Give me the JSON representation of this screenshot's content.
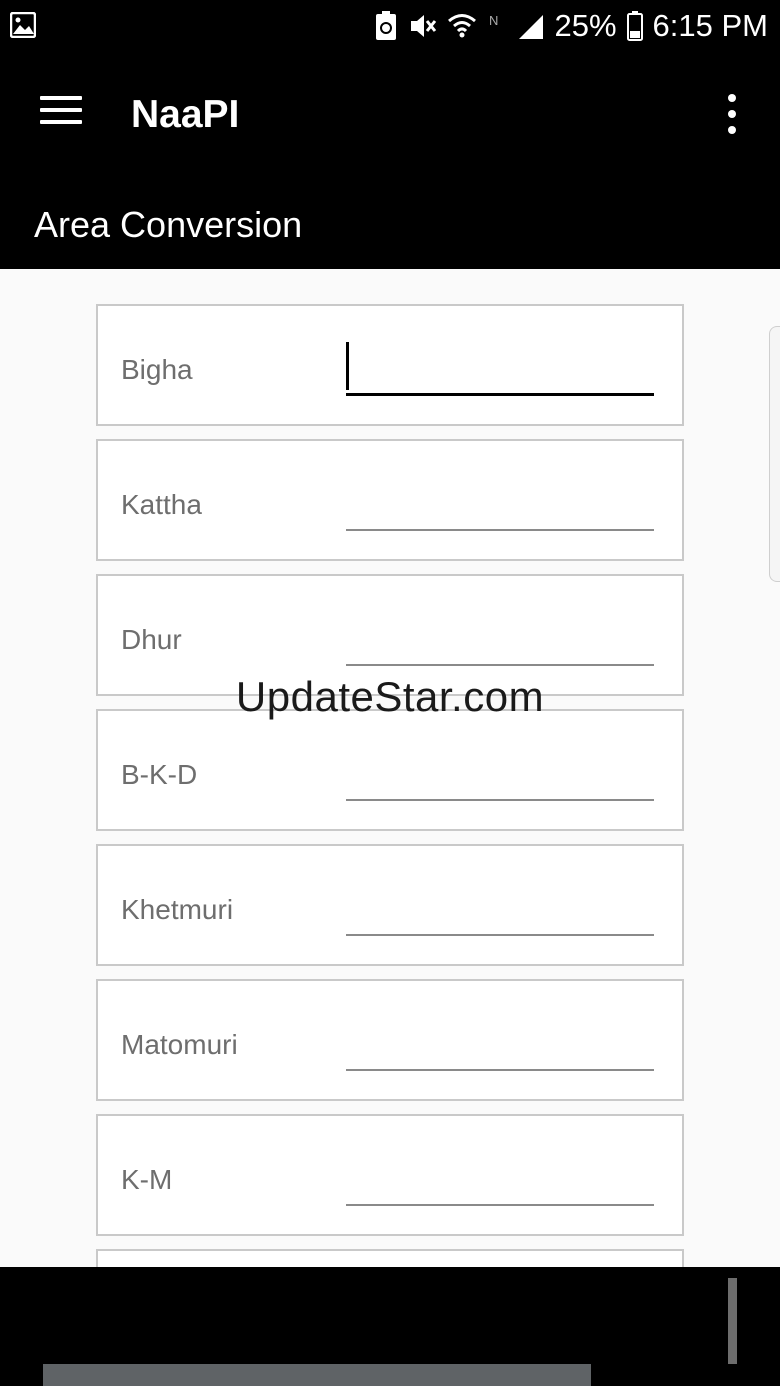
{
  "status_bar": {
    "battery_percent": "25%",
    "time": "6:15 PM",
    "icons": [
      "image-notification-icon",
      "battery-saver-icon",
      "vibrate-mute-icon",
      "wifi-icon",
      "nfc-icon",
      "signal-icon",
      "battery-icon"
    ]
  },
  "app_bar": {
    "title": "NaaPI",
    "menu_icon": "hamburger-menu-icon",
    "overflow_icon": "more-vert-icon"
  },
  "section": {
    "title": "Area Conversion"
  },
  "units": [
    {
      "label": "Bigha",
      "value": "",
      "focused": true
    },
    {
      "label": "Kattha",
      "value": ""
    },
    {
      "label": "Dhur",
      "value": ""
    },
    {
      "label": "B-K-D",
      "value": ""
    },
    {
      "label": "Khetmuri",
      "value": ""
    },
    {
      "label": "Matomuri",
      "value": ""
    },
    {
      "label": "K-M",
      "value": ""
    }
  ],
  "watermark": "UpdateStar.com",
  "colors": {
    "app_bar_bg": "#000000",
    "content_bg": "#fafafa",
    "row_border": "#c9c9c9",
    "label_text": "#6e6e6e"
  }
}
